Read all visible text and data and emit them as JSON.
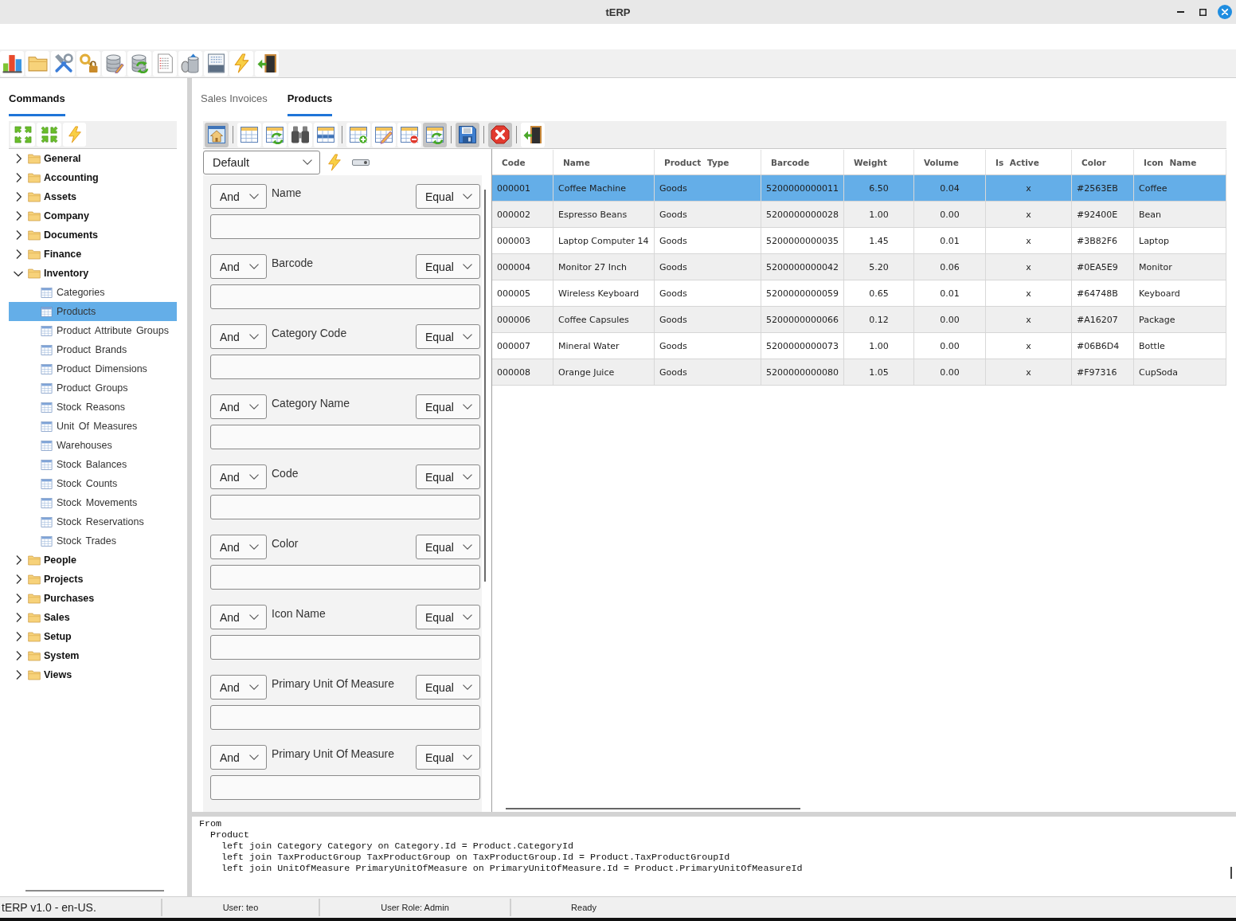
{
  "window": {
    "title": "tERP"
  },
  "sidebar": {
    "tabs": [
      {
        "label": "Commands",
        "selected": true
      }
    ],
    "tree": [
      {
        "label": "General",
        "expanded": false,
        "selected": false
      },
      {
        "label": "Accounting",
        "expanded": false,
        "selected": false
      },
      {
        "label": "Assets",
        "expanded": false,
        "selected": false
      },
      {
        "label": "Company",
        "expanded": false,
        "selected": false
      },
      {
        "label": "Documents",
        "expanded": false,
        "selected": false
      },
      {
        "label": "Finance",
        "expanded": false,
        "selected": false
      },
      {
        "label": "Inventory",
        "expanded": true,
        "selected": false,
        "children": [
          {
            "label": "Categories",
            "selected": false
          },
          {
            "label": "Products",
            "selected": true
          },
          {
            "label": "Product Attribute Groups",
            "selected": false
          },
          {
            "label": "Product Brands",
            "selected": false
          },
          {
            "label": "Product Dimensions",
            "selected": false
          },
          {
            "label": "Product Groups",
            "selected": false
          },
          {
            "label": "Stock Reasons",
            "selected": false
          },
          {
            "label": "Unit Of Measures",
            "selected": false
          },
          {
            "label": "Warehouses",
            "selected": false
          },
          {
            "label": "Stock Balances",
            "selected": false
          },
          {
            "label": "Stock Counts",
            "selected": false
          },
          {
            "label": "Stock Movements",
            "selected": false
          },
          {
            "label": "Stock Reservations",
            "selected": false
          },
          {
            "label": "Stock Trades",
            "selected": false
          }
        ]
      },
      {
        "label": "People",
        "expanded": false,
        "selected": false
      },
      {
        "label": "Projects",
        "expanded": false,
        "selected": false
      },
      {
        "label": "Purchases",
        "expanded": false,
        "selected": false
      },
      {
        "label": "Sales",
        "expanded": false,
        "selected": false
      },
      {
        "label": "Setup",
        "expanded": false,
        "selected": false
      },
      {
        "label": "System",
        "expanded": false,
        "selected": false
      },
      {
        "label": "Views",
        "expanded": false,
        "selected": false
      }
    ]
  },
  "document_tabs": [
    {
      "label": "Sales Invoices",
      "selected": false
    },
    {
      "label": "Products",
      "selected": true
    }
  ],
  "toolbar": {
    "groups": [
      {
        "buttons": [
          {
            "pressed": true
          }
        ]
      },
      {
        "buttons": [
          {
            "pressed": false
          },
          {
            "pressed": false
          },
          {
            "pressed": false
          },
          {
            "pressed": false
          }
        ]
      },
      {
        "buttons": [
          {
            "pressed": false
          },
          {
            "pressed": false
          },
          {
            "pressed": false
          },
          {
            "pressed": true
          }
        ]
      },
      {
        "buttons": [
          {
            "pressed": true
          }
        ]
      },
      {
        "buttons": [
          {
            "pressed": true
          }
        ]
      },
      {
        "buttons": [
          {
            "pressed": false
          }
        ]
      }
    ]
  },
  "filter_panel": {
    "view": "Default",
    "filters": [
      {
        "connector": "And",
        "field": "Name",
        "operator": "Equal"
      },
      {
        "connector": "And",
        "field": "Barcode",
        "operator": "Equal"
      },
      {
        "connector": "And",
        "field": "Category Code",
        "operator": "Equal"
      },
      {
        "connector": "And",
        "field": "Category Name",
        "operator": "Equal"
      },
      {
        "connector": "And",
        "field": "Code",
        "operator": "Equal"
      },
      {
        "connector": "And",
        "field": "Color",
        "operator": "Equal"
      },
      {
        "connector": "And",
        "field": "Icon Name",
        "operator": "Equal"
      },
      {
        "connector": "And",
        "field": "Primary Unit Of Measure",
        "operator": "Equal"
      },
      {
        "connector": "And",
        "field": "Primary Unit Of Measure",
        "operator": "Equal"
      }
    ]
  },
  "table": {
    "columns": [
      "Code",
      "Name",
      "Product Type",
      "Barcode",
      "Weight",
      "Volume",
      "Is Active",
      "Color",
      "Icon Name"
    ],
    "rows": [
      {
        "selected": true,
        "cells": [
          "000001",
          "Coffee Machine",
          "Goods",
          "5200000000011",
          "6.50",
          "0.04",
          "x",
          "#2563EB",
          "Coffee"
        ]
      },
      {
        "selected": false,
        "cells": [
          "000002",
          "Espresso Beans",
          "Goods",
          "5200000000028",
          "1.00",
          "0.00",
          "x",
          "#92400E",
          "Bean"
        ]
      },
      {
        "selected": false,
        "cells": [
          "000003",
          "Laptop Computer 14",
          "Goods",
          "5200000000035",
          "1.45",
          "0.01",
          "x",
          "#3B82F6",
          "Laptop"
        ]
      },
      {
        "selected": false,
        "cells": [
          "000004",
          "Monitor 27 Inch",
          "Goods",
          "5200000000042",
          "5.20",
          "0.06",
          "x",
          "#0EA5E9",
          "Monitor"
        ]
      },
      {
        "selected": false,
        "cells": [
          "000005",
          "Wireless Keyboard",
          "Goods",
          "5200000000059",
          "0.65",
          "0.01",
          "x",
          "#64748B",
          "Keyboard"
        ]
      },
      {
        "selected": false,
        "cells": [
          "000006",
          "Coffee Capsules",
          "Goods",
          "5200000000066",
          "0.12",
          "0.00",
          "x",
          "#A16207",
          "Package"
        ]
      },
      {
        "selected": false,
        "cells": [
          "000007",
          "Mineral Water",
          "Goods",
          "5200000000073",
          "1.00",
          "0.00",
          "x",
          "#06B6D4",
          "Bottle"
        ]
      },
      {
        "selected": false,
        "cells": [
          "000008",
          "Orange Juice",
          "Goods",
          "5200000000080",
          "1.05",
          "0.00",
          "x",
          "#F97316",
          "CupSoda"
        ]
      }
    ]
  },
  "query_editor": {
    "lines": [
      "From",
      "  Product",
      "    left join Category Category on Category.Id = Product.CategoryId",
      "    left join TaxProductGroup TaxProductGroup on TaxProductGroup.Id = Product.TaxProductGroupId",
      "    left join UnitOfMeasure PrimaryUnitOfMeasure on PrimaryUnitOfMeasure.Id = Product.PrimaryUnitOfMeasureId"
    ]
  },
  "status_bar": {
    "sections": [
      "tERP v1.0 - en-US.",
      "User: teo",
      "User Role: Admin",
      "Ready"
    ]
  }
}
